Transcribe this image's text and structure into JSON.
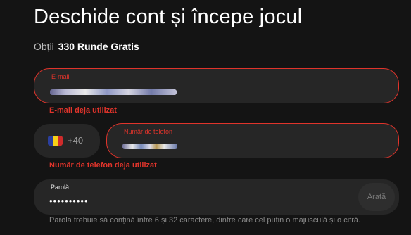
{
  "header": {
    "title": "Deschide cont și începe jocul",
    "subtitle_prefix": "Obții",
    "subtitle_bold": "330 Runde Gratis"
  },
  "email": {
    "label": "E-mail",
    "error": "E-mail deja utilizat"
  },
  "phone": {
    "prefix": "+40",
    "flag_colors": [
      "#2b3f9e",
      "#f7d117",
      "#cf2b2b"
    ],
    "label": "Număr de telefon",
    "error": "Număr de telefon deja utilizat"
  },
  "password": {
    "label": "Parolă",
    "value_masked": "••••••••••",
    "show_button": "Arată",
    "hint": "Parola trebuie să conțină între 6 și 32 caractere, dintre care cel puțin o majusculă și o cifră."
  },
  "colors": {
    "error": "#e0342b",
    "field_bg": "#262626",
    "page_bg": "#141414"
  }
}
